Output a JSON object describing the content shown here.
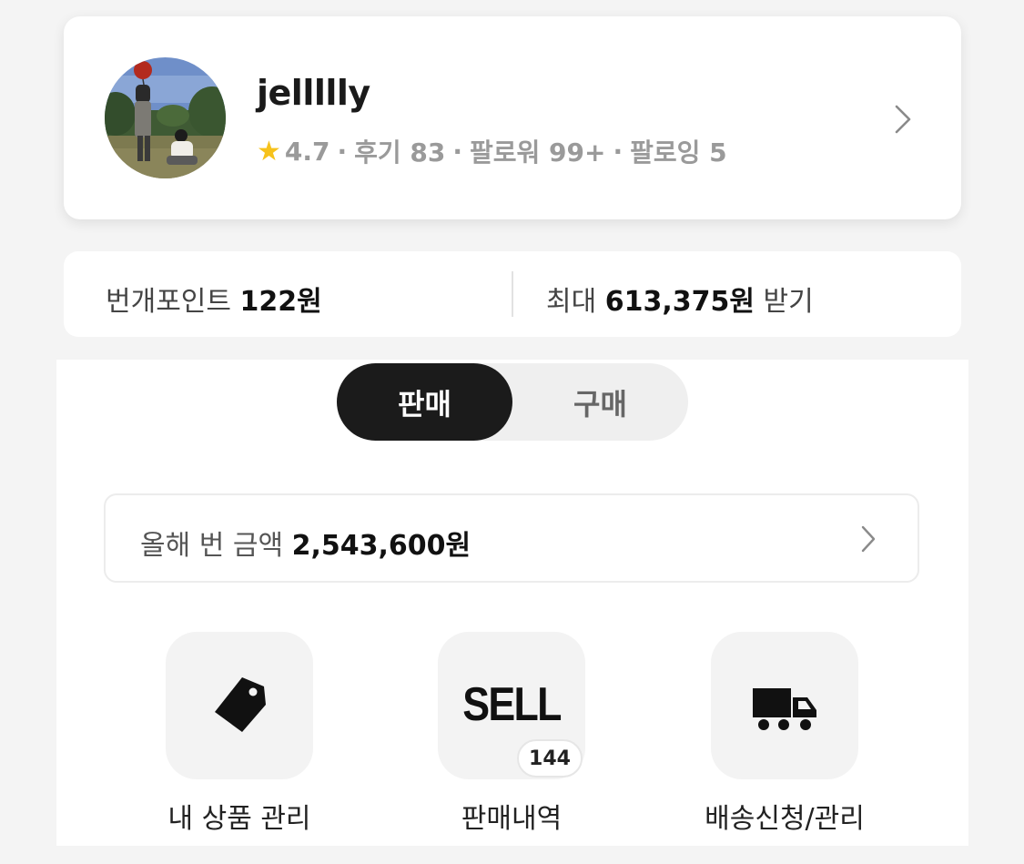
{
  "profile": {
    "username": "jellllly",
    "rating": "4.7",
    "reviews": "후기 83",
    "followers": "팔로워 99+",
    "following": "팔로잉 5",
    "separator": "·"
  },
  "points": {
    "label": "번개포인트",
    "value": "122원",
    "max_prefix": "최대",
    "max_value": "613,375원",
    "max_suffix": "받기"
  },
  "toggle": {
    "sell_label": "판매",
    "buy_label": "구매",
    "selected": "판매"
  },
  "earnings": {
    "label": "올해 번 금액",
    "value": "2,543,600원"
  },
  "menu": {
    "items": [
      {
        "label": "내 상품 관리",
        "icon": "price-tag-icon"
      },
      {
        "label": "판매내역",
        "icon": "sell-icon",
        "icon_text": "SELL",
        "badge": "144"
      },
      {
        "label": "배송신청/관리",
        "icon": "truck-icon"
      }
    ]
  },
  "colors": {
    "star": "#f6c21c",
    "toggle_active_bg": "#1b1b1b",
    "page_bg": "#f4f4f4"
  }
}
